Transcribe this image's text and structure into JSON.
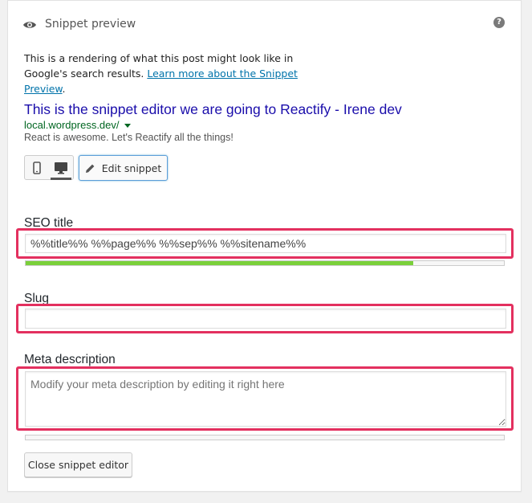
{
  "header": {
    "title": "Snippet preview",
    "eye_icon": "eye-icon",
    "help_icon": "question-mark-icon",
    "help_glyph": "?"
  },
  "intro": {
    "text": "This is a rendering of what this post might look like in Google's search results. ",
    "link_text": "Learn more about the Snippet Preview",
    "suffix": "."
  },
  "snippet": {
    "title": "This is the snippet editor we are going to Reactify - Irene dev",
    "url": "local.wordpress.dev/",
    "description": "React is awesome. Let's Reactify all the things!"
  },
  "mode_switch": {
    "mobile_icon": "mobile-icon",
    "desktop_icon": "desktop-icon",
    "active": "desktop"
  },
  "edit_button": {
    "label": "Edit snippet",
    "icon": "pencil-icon"
  },
  "fields": {
    "seo_title": {
      "label": "SEO title",
      "value": "%%title%% %%page%% %%sep%% %%sitename%%",
      "progress": 0.81
    },
    "slug": {
      "label": "Slug",
      "value": ""
    },
    "meta_description": {
      "label": "Meta description",
      "placeholder": "Modify your meta description by editing it right here",
      "progress": 0
    }
  },
  "close_button": {
    "label": "Close snippet editor"
  },
  "colors": {
    "highlight": "#e3305f",
    "progress_good": "#7ad03a",
    "google_title": "#1a0dab",
    "google_url": "#006621",
    "link": "#0073aa"
  }
}
